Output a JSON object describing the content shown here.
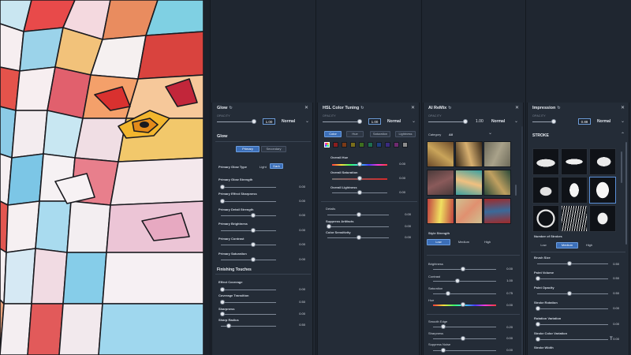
{
  "colors": {
    "accent": "#3c6fb8",
    "panel_bg": "#242c37",
    "text": "#d8dde5"
  },
  "glow": {
    "title": "Glow",
    "opacity_label": "OPACITY",
    "opacity_value": "1.00",
    "blend_mode": "Normal",
    "section_glow": "Glow",
    "tabs": [
      "Primary",
      "Secondary"
    ],
    "type_label": "Primary Glow Type",
    "type_options": [
      "Light",
      "Dark"
    ],
    "sliders": [
      {
        "label": "Primary Glow Strength",
        "value": "0.00"
      },
      {
        "label": "Primary Effect Sharpness",
        "value": "0.00"
      },
      {
        "label": "Primary Detail Strength",
        "value": "0.00"
      },
      {
        "label": "Primary Brightness",
        "value": "0.00"
      },
      {
        "label": "Primary Contrast",
        "value": "0.00"
      },
      {
        "label": "Primary Saturation",
        "value": "0.00"
      }
    ],
    "section_finishing": "Finishing Touches",
    "finishing": [
      {
        "label": "Effect Coverage",
        "value": "0.00"
      },
      {
        "label": "Coverage Transition",
        "value": "0.50"
      },
      {
        "label": "Sharpness",
        "value": "0.00"
      },
      {
        "label": "Sharp Radius",
        "value": "0.50"
      }
    ]
  },
  "hsl": {
    "title": "HSL Color Tuning",
    "opacity_label": "OPACITY",
    "opacity_value": "1.00",
    "blend_mode": "Normal",
    "tabs": [
      "Color",
      "Hue",
      "Saturation",
      "Lightness"
    ],
    "swatch_colors": [
      "#f2c94c",
      "#8b1e1e",
      "#7a3a16",
      "#7a6e1a",
      "#3f6f1f",
      "#1f6f4f",
      "#1f3f7f",
      "#3a2a7f",
      "#6f2a6f",
      "#8c8c8c"
    ],
    "sliders": [
      {
        "label": "Overall Hue",
        "value": "0.00"
      },
      {
        "label": "Overall Saturation",
        "value": "0.00"
      },
      {
        "label": "Overall Lightness",
        "value": "0.00"
      }
    ],
    "details_label": "Details",
    "details_value": "0.00",
    "artifacts_label": "Suppress Artifacts",
    "artifacts_value": "0.00",
    "sensitivity_label": "Color Sensitivity",
    "sensitivity_value": "0.00"
  },
  "remix": {
    "title": "AI ReMix",
    "opacity_label": "OPACITY",
    "opacity_value": "1.00",
    "blend_mode": "Normal",
    "category_label": "Category",
    "category_value": "All",
    "style_strength_label": "Style Strength",
    "strength_options": [
      "Low",
      "Medium",
      "High"
    ],
    "sliders": [
      {
        "label": "Brightness",
        "value": "0.00"
      },
      {
        "label": "Contrast",
        "value": "1.00"
      },
      {
        "label": "Saturation",
        "value": "0.75"
      },
      {
        "label": "Hue",
        "value": "0.00"
      },
      {
        "label": "Smooth Edge",
        "value": "0.20"
      },
      {
        "label": "Sharpness",
        "value": "0.00"
      },
      {
        "label": "Suppress Noise",
        "value": "0.00"
      }
    ]
  },
  "impression": {
    "title": "Impression",
    "opacity_label": "OPACITY",
    "opacity_value": "0.88",
    "blend_mode": "Normal",
    "section_stroke": "STROKE",
    "strokes_label": "Number of Strokes",
    "strokes_options": [
      "Low",
      "Medium",
      "High"
    ],
    "sliders": [
      {
        "label": "Brush Size",
        "value": "0.50"
      },
      {
        "label": "Paint Volume",
        "value": "0.50"
      },
      {
        "label": "Paint Opacity",
        "value": "0.50"
      },
      {
        "label": "Stroke Rotation",
        "value": "0.00"
      },
      {
        "label": "Rotation Variation",
        "value": "0.00"
      },
      {
        "label": "Stroke Color Variation",
        "value": "0.00"
      },
      {
        "label": "Stroke Width",
        "value": ""
      }
    ],
    "footer_mark": "T"
  }
}
